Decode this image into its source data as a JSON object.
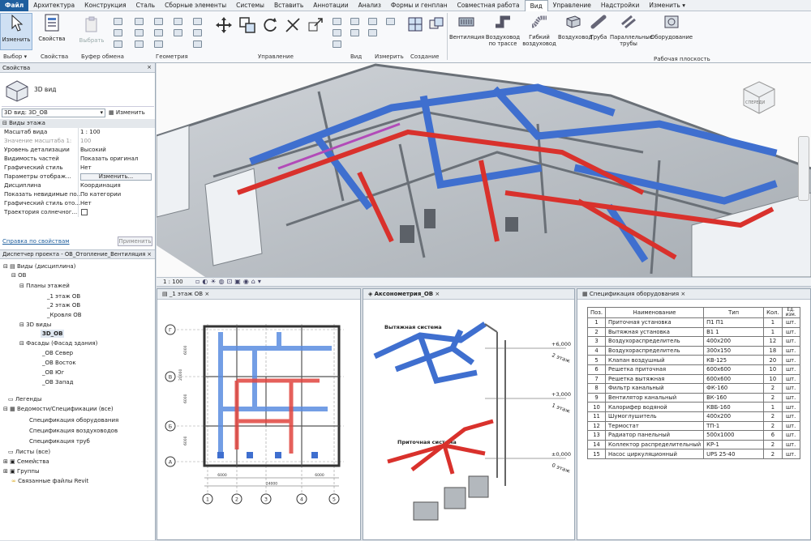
{
  "tabs": [
    "Файл",
    "Архитектура",
    "Конструкция",
    "Сталь",
    "Сборные элементы",
    "Системы",
    "Вставить",
    "Аннотации",
    "Анализ",
    "Формы и генплан",
    "Совместная работа",
    "Вид",
    "Управление",
    "Надстройки",
    "Изменить"
  ],
  "ribbon": {
    "modify": "Изменить",
    "select": "Выбор",
    "properties": "Свойства",
    "clipboard": "Буфер обмена",
    "select_disabled": "Выбрать",
    "geometry": "Геометрия",
    "manage": "Управление",
    "view": "Вид",
    "measure": "Измерить",
    "create": "Создание",
    "ventilation": "Вентиляция",
    "duct_route": "Воздуховод по трассе",
    "flex_duct": "Гибкий воздуховод",
    "ducts": "Воздуховод",
    "pipe": "Труба",
    "parallel_pipes": "Параллельные трубы",
    "equipment": "Оборудование",
    "workplane": "Рабочая плоскость"
  },
  "props": {
    "title": "Свойства",
    "type_name": "3D вид",
    "selector": "3D вид: 3D_ОВ",
    "edit_type": "Изменить тип",
    "section": "Виды этажа",
    "rows": [
      {
        "k": "Масштаб вида",
        "v": "1 : 100"
      },
      {
        "k": "Значение масштаба  1:",
        "v": "100"
      },
      {
        "k": "Уровень детализации",
        "v": "Высокий"
      },
      {
        "k": "Видимость частей",
        "v": "Показать оригинал"
      },
      {
        "k": "Графический стиль",
        "v": "Нет"
      },
      {
        "k": "Параметры отображ...",
        "v": "Изменить..."
      },
      {
        "k": "Дисциплина",
        "v": "Координация"
      },
      {
        "k": "Показать невидимые по...",
        "v": "По категории"
      },
      {
        "k": "Графический стиль ото...",
        "v": "Нет"
      },
      {
        "k": "Траектория солнечног...",
        "v": ""
      }
    ],
    "help": "Справка по свойствам",
    "apply": "Применить"
  },
  "browser": {
    "title": "Диспетчер проекта - ОВ_Отопление_Вентиляция",
    "items": [
      "Виды (дисциплина)",
      "ОВ",
      "Планы этажей",
      "_1 этаж ОВ",
      "_2 этаж ОВ",
      "_Кровля ОВ",
      "3D виды",
      "3D_ОВ",
      "Фасады (Фасад здания)",
      "_ОВ Север",
      "_ОВ Восток",
      "_ОВ Юг",
      "_ОВ Запад",
      "Легенды",
      "Ведомости/Спецификации (все)",
      "Спецификация оборудования",
      "Спецификация воздуховодов",
      "Спецификация труб",
      "Листы (все)",
      "Семейства",
      "Группы",
      "Связанные файлы Revit"
    ]
  },
  "viewbar": {
    "scale": "1 : 100"
  },
  "viewcube": {
    "front": "СПЕРЕДИ"
  },
  "plan": {
    "title": "_1 этаж ОВ",
    "rows": [
      "Г",
      "В",
      "Б",
      "А"
    ],
    "cols": [
      "1",
      "2",
      "3",
      "4",
      "5"
    ],
    "dims": [
      "24000",
      "6000",
      "6000",
      "6000",
      "6000",
      "20000",
      "6000"
    ]
  },
  "axo": {
    "title": "Аксонометрия_ОВ",
    "exhaust": "Вытяжная система",
    "supply": "Приточная система",
    "levels": [
      "+6,000",
      "2 этаж",
      "+3,000",
      "1 этаж",
      "±0,000",
      "0 этаж"
    ]
  },
  "spec": {
    "title": "Спецификация оборудования",
    "headers": [
      "Поз.",
      "Наименование",
      "Тип",
      "Кол.",
      "Ед. изм."
    ],
    "rows": [
      [
        "1",
        "Приточная установка",
        "П1 П1",
        "1",
        "шт."
      ],
      [
        "2",
        "Вытяжная установка",
        "В1 1",
        "1",
        "шт."
      ],
      [
        "3",
        "Воздухораспределитель",
        "400x200",
        "12",
        "шт."
      ],
      [
        "4",
        "Воздухораспределитель",
        "300x150",
        "18",
        "шт."
      ],
      [
        "5",
        "Клапан воздушный",
        "КВ-125",
        "20",
        "шт."
      ],
      [
        "6",
        "Решетка приточная",
        "600x600",
        "10",
        "шт."
      ],
      [
        "7",
        "Решетка вытяжная",
        "600x600",
        "10",
        "шт."
      ],
      [
        "8",
        "Фильтр канальный",
        "ФК-160",
        "2",
        "шт."
      ],
      [
        "9",
        "Вентилятор канальный",
        "ВК-160",
        "2",
        "шт."
      ],
      [
        "10",
        "Калорифер водяной",
        "КВБ-160",
        "1",
        "шт."
      ],
      [
        "11",
        "Шумоглушитель",
        "400x200",
        "2",
        "шт."
      ],
      [
        "12",
        "Термостат",
        "ТП-1",
        "2",
        "шт."
      ],
      [
        "13",
        "Радиатор панельный",
        "500x1000",
        "6",
        "шт."
      ],
      [
        "14",
        "Коллектор распределительный",
        "КР-1",
        "2",
        "шт."
      ],
      [
        "15",
        "Насос циркуляционный",
        "UPS 25-40",
        "2",
        "шт."
      ]
    ]
  },
  "colors": {
    "accent": "#1f5f9e",
    "supply_duct": "#d9312c",
    "exhaust_duct": "#3f6fcf",
    "wall": "#9aa0a6"
  }
}
